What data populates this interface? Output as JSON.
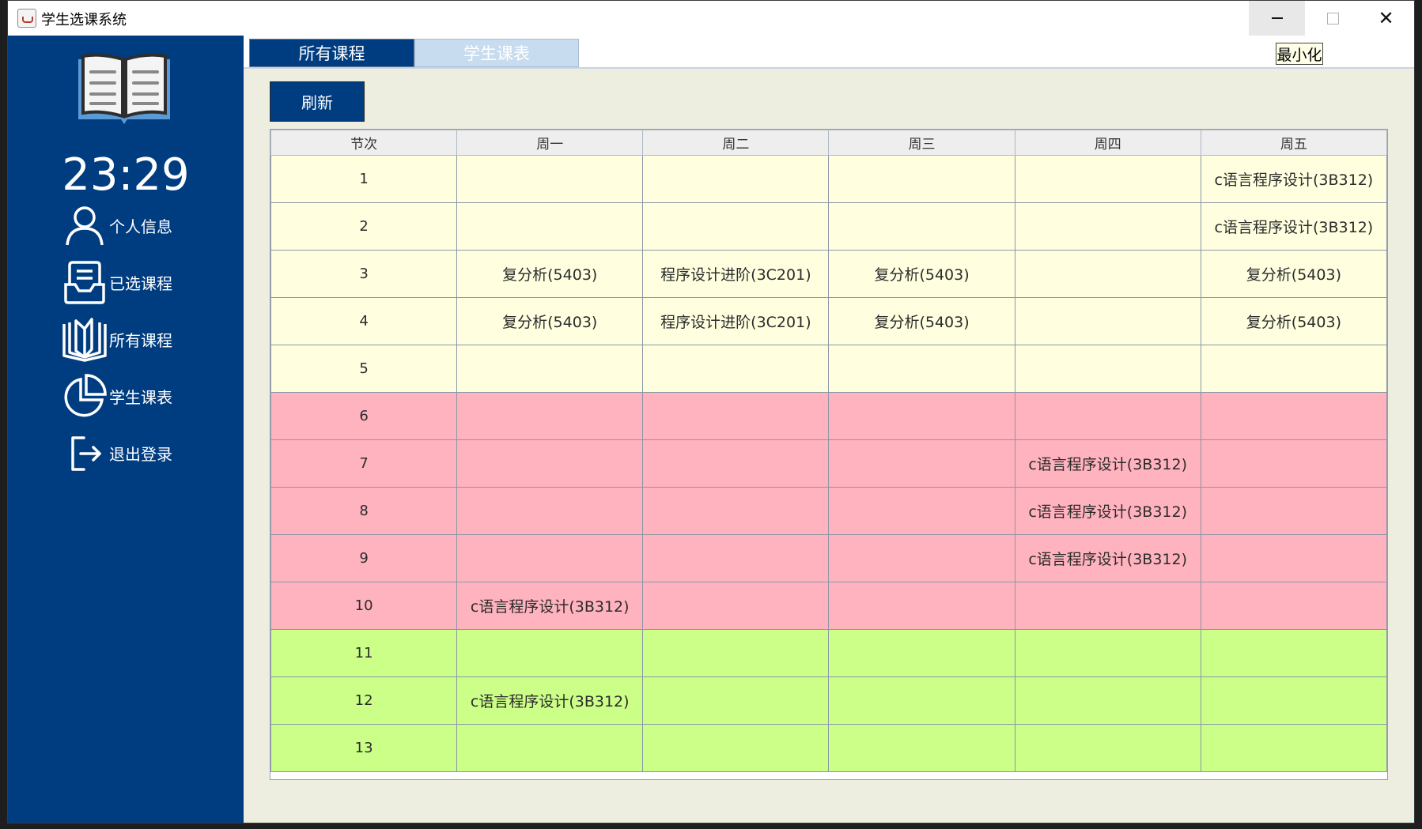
{
  "window": {
    "title": "学生选课系统",
    "close_glyph": "✕"
  },
  "sidebar": {
    "clock": "23:29",
    "items": [
      {
        "label": "个人信息",
        "icon": "user-icon"
      },
      {
        "label": "已选课程",
        "icon": "inbox-icon"
      },
      {
        "label": "所有课程",
        "icon": "open-book-icon"
      },
      {
        "label": "学生课表",
        "icon": "pie-chart-icon"
      },
      {
        "label": "退出登录",
        "icon": "logout-icon"
      }
    ]
  },
  "tabs": [
    {
      "label": "所有课程"
    },
    {
      "label": "学生课表"
    }
  ],
  "minimize_label": "最小化",
  "refresh_label": "刷新",
  "colors": {
    "sidebar": "#003d80",
    "morning": "#ffffe0",
    "afternoon": "#ffb3bf",
    "evening": "#ccff88"
  },
  "schedule": {
    "columns": [
      "节次",
      "周一",
      "周二",
      "周三",
      "周四",
      "周五"
    ],
    "rows": [
      {
        "period": "1",
        "band": "morning",
        "cells": [
          "",
          "",
          "",
          "",
          "c语言程序设计(3B312)"
        ]
      },
      {
        "period": "2",
        "band": "morning",
        "cells": [
          "",
          "",
          "",
          "",
          "c语言程序设计(3B312)"
        ]
      },
      {
        "period": "3",
        "band": "morning",
        "cells": [
          "复分析(5403)",
          "程序设计进阶(3C201)",
          "复分析(5403)",
          "",
          "复分析(5403)"
        ]
      },
      {
        "period": "4",
        "band": "morning",
        "cells": [
          "复分析(5403)",
          "程序设计进阶(3C201)",
          "复分析(5403)",
          "",
          "复分析(5403)"
        ]
      },
      {
        "period": "5",
        "band": "morning",
        "cells": [
          "",
          "",
          "",
          "",
          ""
        ]
      },
      {
        "period": "6",
        "band": "afternoon",
        "cells": [
          "",
          "",
          "",
          "",
          ""
        ]
      },
      {
        "period": "7",
        "band": "afternoon",
        "cells": [
          "",
          "",
          "",
          "c语言程序设计(3B312)",
          ""
        ]
      },
      {
        "period": "8",
        "band": "afternoon",
        "cells": [
          "",
          "",
          "",
          "c语言程序设计(3B312)",
          ""
        ]
      },
      {
        "period": "9",
        "band": "afternoon",
        "cells": [
          "",
          "",
          "",
          "c语言程序设计(3B312)",
          ""
        ]
      },
      {
        "period": "10",
        "band": "afternoon",
        "cells": [
          "c语言程序设计(3B312)",
          "",
          "",
          "",
          ""
        ]
      },
      {
        "period": "11",
        "band": "evening",
        "cells": [
          "",
          "",
          "",
          "",
          ""
        ]
      },
      {
        "period": "12",
        "band": "evening",
        "cells": [
          "c语言程序设计(3B312)",
          "",
          "",
          "",
          ""
        ]
      },
      {
        "period": "13",
        "band": "evening",
        "cells": [
          "",
          "",
          "",
          "",
          ""
        ]
      }
    ]
  }
}
